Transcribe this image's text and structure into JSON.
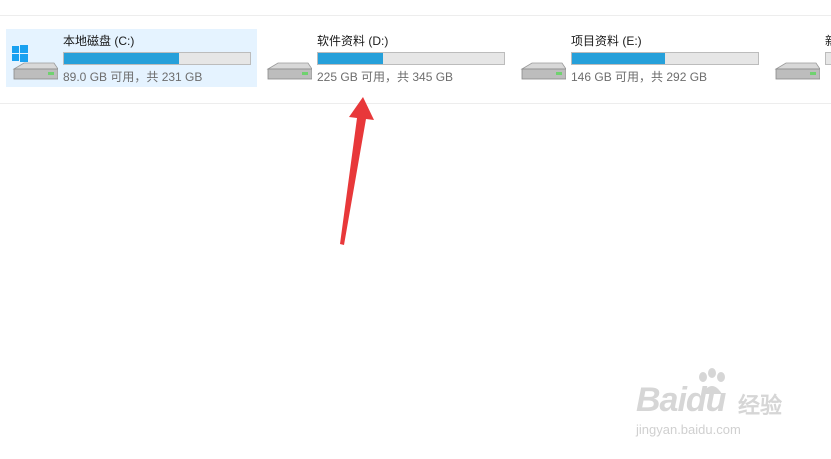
{
  "drives": [
    {
      "name": "本地磁盘 (C:)",
      "space": "89.0 GB 可用，共 231 GB",
      "used_fraction": 0.62,
      "selected": true,
      "icon": "windows-drive-icon"
    },
    {
      "name": "软件资料 (D:)",
      "space": "225 GB 可用，共 345 GB",
      "used_fraction": 0.35,
      "selected": false,
      "icon": "hard-drive-icon"
    },
    {
      "name": "项目资料 (E:)",
      "space": "146 GB 可用，共 292 GB",
      "used_fraction": 0.5,
      "selected": false,
      "icon": "hard-drive-icon"
    },
    {
      "name": "新",
      "space": "",
      "used_fraction": 0.0,
      "selected": false,
      "icon": "hard-drive-icon"
    }
  ],
  "colors": {
    "bar_fill": "#26a0da",
    "bar_track": "#e6e6e6",
    "selected_bg": "#e5f3ff",
    "arrow": "#e8383a"
  },
  "watermark": {
    "brand": "Baidu",
    "jingyan": "经验",
    "url": "jingyan.baidu.com"
  }
}
